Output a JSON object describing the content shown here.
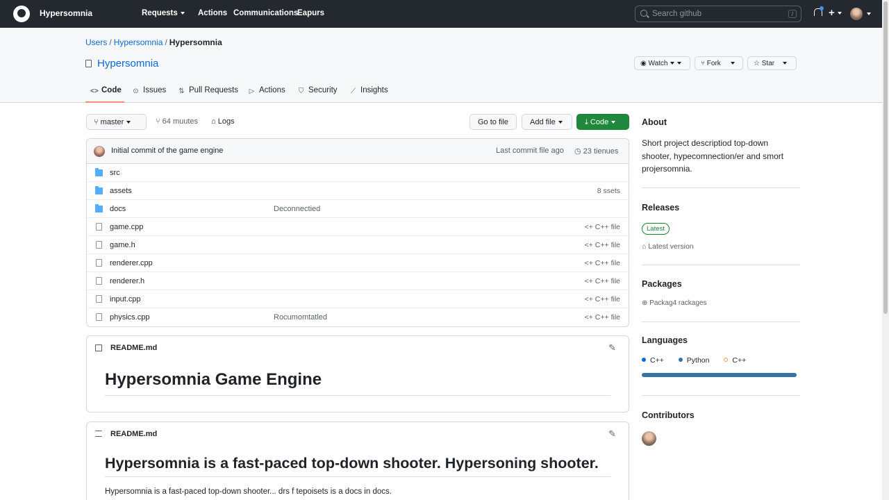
{
  "nav": {
    "brand": "Hypersomnia",
    "links": [
      "Requests",
      "Actions",
      "Communications",
      "Eapurs"
    ],
    "search_placeholder": "Search github",
    "search_slash": "/",
    "plus": "+"
  },
  "breadcrumb": {
    "root": "Users",
    "owner": "Hypersomnia",
    "repo": "Hypersomnia",
    "sep": "/"
  },
  "repo": {
    "name": "Hypersomnia",
    "watch_label": "Watch",
    "fork_label": "Fork",
    "star_label": "Star"
  },
  "tabs": [
    "Code",
    "Issues",
    "Pull Requests",
    "Actions",
    "Security",
    "Insights"
  ],
  "tab_icons": [
    "<>",
    "⊙",
    "⇅",
    "▷",
    "⛉",
    "⟋"
  ],
  "toolbar": {
    "branch": "master",
    "commits": "64 muutes",
    "logs": "Logs",
    "go_to_file": "Go to file",
    "add_file": "Add file",
    "code": "Code"
  },
  "commit": {
    "message": "Initial commit of the game engine",
    "when": "Last commit file ago",
    "history": "23 tienues"
  },
  "files": [
    {
      "name": "src",
      "type": "dir",
      "message": "",
      "meta": ""
    },
    {
      "name": "assets",
      "type": "dir",
      "message": "",
      "meta": "8 ssets"
    },
    {
      "name": "docs",
      "type": "dir",
      "message": "Deconnectied",
      "meta": ""
    },
    {
      "name": "game.cpp",
      "type": "file",
      "message": "",
      "meta": "<+ C++ file"
    },
    {
      "name": "game.h",
      "type": "file",
      "message": "",
      "meta": "<+ C++ file"
    },
    {
      "name": "renderer.cpp",
      "type": "file",
      "message": "",
      "meta": "<+ C++ file"
    },
    {
      "name": "renderer.h",
      "type": "file",
      "message": "",
      "meta": "<+ C++ file"
    },
    {
      "name": "input.cpp",
      "type": "file",
      "message": "",
      "meta": "<+ C++ file"
    },
    {
      "name": "physics.cpp",
      "type": "file",
      "message": "Rocumomtatled",
      "meta": "<+ C++ file"
    }
  ],
  "readme1": {
    "filename": "README.md",
    "heading": "Hypersomnia Game Engine"
  },
  "readme2": {
    "filename": "README.md",
    "heading": "Hypersomnia is a fast-paced top-down shooter. Hypersoning shooter.",
    "paragraph": "Hypersomnia is a fast-paced top-down shooter... drs f tepoisets is a docs in docs."
  },
  "sidebar": {
    "about_title": "About",
    "about_text": "Short project descriptiod top-down shooter, hypecomnection/er and smort projersomnia.",
    "releases_title": "Releases",
    "release_badge": "Latest",
    "release_text": "Latest version",
    "packages_title": "Packages",
    "packages_text": "Packag4 rackages",
    "languages_title": "Languages",
    "languages": [
      {
        "name": "C++",
        "color": "#0969da"
      },
      {
        "name": "Python",
        "color": "#3572a5"
      },
      {
        "name": "C++",
        "color": "#f0a15c"
      }
    ],
    "contributors_title": "Contributors"
  },
  "colors": {
    "nav_bg": "#24292f",
    "link": "#0969da",
    "green": "#1f883d",
    "tab_underline": "#fd8c73",
    "lang_bar": "#3572a5"
  }
}
